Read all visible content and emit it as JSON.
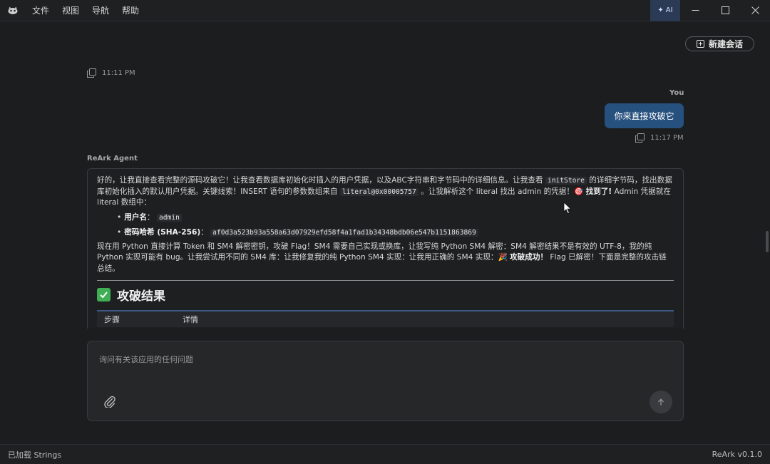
{
  "menu": {
    "items": [
      "文件",
      "视图",
      "导航",
      "帮助"
    ]
  },
  "ai_button": {
    "label": "AI"
  },
  "new_chat": {
    "label": "新建会话"
  },
  "messages": {
    "prev_timestamp": "11:11 PM",
    "user": {
      "sender": "You",
      "text": "你来直接攻破它",
      "timestamp": "11:17 PM"
    },
    "agent": {
      "sender": "ReArk Agent",
      "p1_a": "好的，让我直接查看完整的源码攻破它！让我查看数据库初始化时插入的用户凭据，以及ABC字符串和字节码中的详细信息。让我查看 ",
      "p1_code1": "initStore",
      "p1_b": " 的详细字节码，找出数据库初始化插入的默认用户凭据。关键线索！INSERT 语句的参数数组来自 ",
      "p1_code2": "literal@0x00005757",
      "p1_c": " 。让我解析这个 literal 找出 admin 的凭据！🎯 ",
      "p1_bold": "找到了!",
      "p1_d": " Admin 凭据就在 literal 数组中：",
      "b1_label": "用户名",
      "b1_sep": "：",
      "b1_value": "admin",
      "b2_label": "密码哈希 (SHA-256)",
      "b2_sep": "：",
      "b2_value": "af0d3a523b93a558a63d07929efd58f4a1fad1b34348bdb06e547b1151863869",
      "p2_a": "现在用 Python 直接计算 Token 和 SM4 解密密钥，攻破 Flag！SM4 需要自己实现或换库，让我写纯 Python SM4 解密：SM4 解密结果不是有效的 UTF-8，我的纯 Python 实现可能有 bug。让我尝试用不同的 SM4 库：让我修复我的纯 Python SM4 实现：让我用正确的 SM4 实现：🎉 ",
      "p2_bold": "攻破成功！",
      "p2_b": " Flag 已解密！下面是完整的攻击链总结。",
      "result_title": "攻破结果",
      "table_headers": [
        "步骤",
        "详情"
      ]
    }
  },
  "input": {
    "placeholder": "询问有关该应用的任何问题"
  },
  "status": {
    "left": "已加载 Strings",
    "right": "ReArk v0.1.0"
  }
}
